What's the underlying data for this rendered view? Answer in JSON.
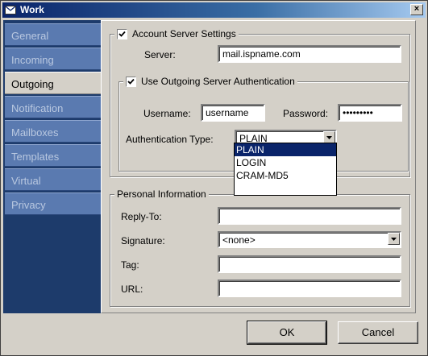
{
  "window": {
    "title": "Work",
    "close_label": "×"
  },
  "sidebar": {
    "items": [
      {
        "label": "General",
        "active": false
      },
      {
        "label": "Incoming",
        "active": false
      },
      {
        "label": "Outgoing",
        "active": true
      },
      {
        "label": "Notification",
        "active": false
      },
      {
        "label": "Mailboxes",
        "active": false
      },
      {
        "label": "Templates",
        "active": false
      },
      {
        "label": "Virtual",
        "active": false
      },
      {
        "label": "Privacy",
        "active": false
      }
    ]
  },
  "account_server": {
    "legend": "Account Server Settings",
    "checked": true,
    "server_label": "Server:",
    "server_value": "mail.ispname.com",
    "auth": {
      "legend": "Use Outgoing Server Authentication",
      "checked": true,
      "username_label": "Username:",
      "username_value": "username",
      "password_label": "Password:",
      "password_value": "•••••••••",
      "auth_type_label": "Authentication Type:",
      "auth_type_value": "PLAIN",
      "auth_type_options": [
        "PLAIN",
        "LOGIN",
        "CRAM-MD5"
      ]
    }
  },
  "personal_info": {
    "legend": "Personal Information",
    "reply_to_label": "Reply-To:",
    "reply_to_value": "",
    "signature_label": "Signature:",
    "signature_value": "<none>",
    "tag_label": "Tag:",
    "tag_value": "",
    "url_label": "URL:",
    "url_value": ""
  },
  "buttons": {
    "ok": "OK",
    "cancel": "Cancel"
  },
  "colors": {
    "selection": "#0a246a",
    "sidebar": "#1d3b6b",
    "face": "#d4d0c8"
  }
}
